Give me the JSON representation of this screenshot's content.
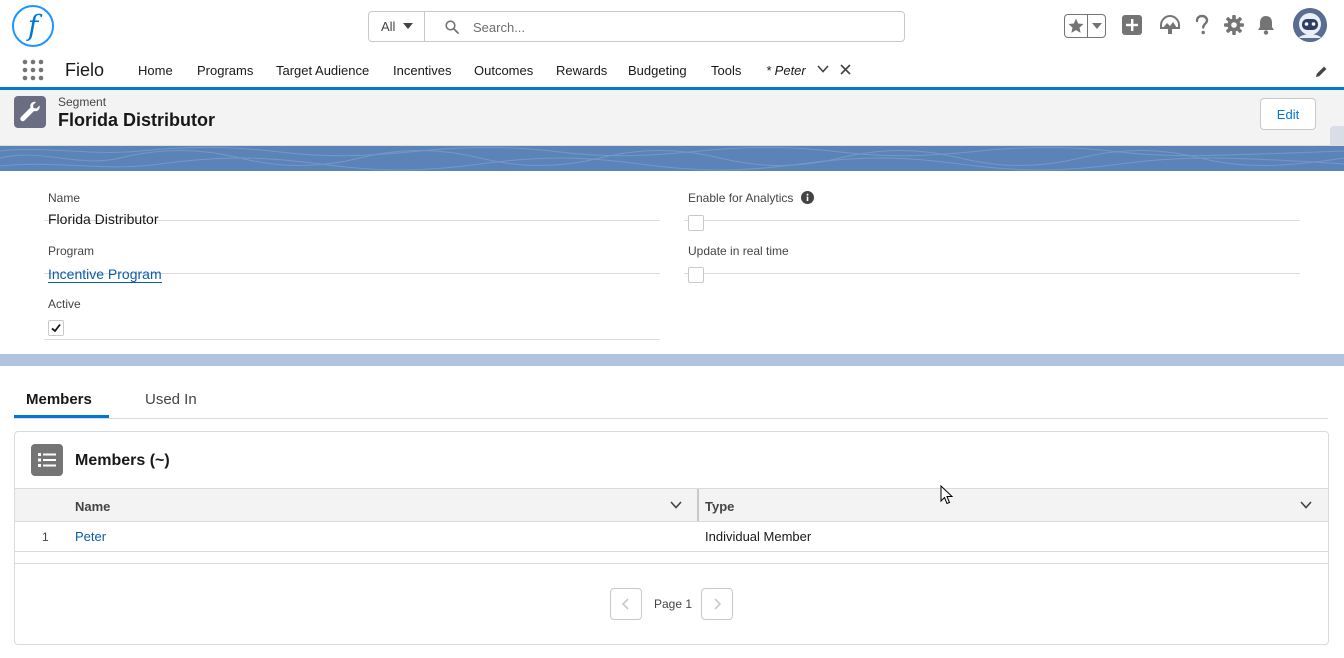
{
  "global_header": {
    "logo_letter": "f",
    "search_scope": "All",
    "search_placeholder": "Search...",
    "icons": [
      "favorites-star-icon",
      "favorites-list-icon",
      "global-create-icon",
      "trailhead-icon",
      "help-icon",
      "setup-gear-icon",
      "notifications-bell-icon",
      "user-avatar"
    ]
  },
  "nav": {
    "app_name": "Fielo",
    "items": [
      "Home",
      "Programs",
      "Target Audience",
      "Incentives",
      "Outcomes",
      "Rewards",
      "Budgeting",
      "Tools"
    ],
    "active_tab": "* Peter"
  },
  "record": {
    "object_label": "Segment",
    "title": "Florida Distributor",
    "edit_label": "Edit"
  },
  "details": {
    "name_label": "Name",
    "name_value": "Florida Distributor",
    "program_label": "Program",
    "program_value": "Incentive Program",
    "active_label": "Active",
    "active_checked": true,
    "analytics_label": "Enable for Analytics",
    "analytics_checked": false,
    "realtime_label": "Update in real time",
    "realtime_checked": false
  },
  "related": {
    "tabs": [
      "Members",
      "Used In"
    ],
    "active_tab": "Members",
    "list_title": "Members (~)",
    "columns": [
      "Name",
      "Type"
    ],
    "rows": [
      {
        "num": "1",
        "name": "Peter",
        "type": "Individual Member"
      }
    ],
    "page_label": "Page 1"
  },
  "colors": {
    "brand_blue": "#0176d3",
    "link_blue": "#0b5cab",
    "band_blue": "#5b83b8"
  }
}
